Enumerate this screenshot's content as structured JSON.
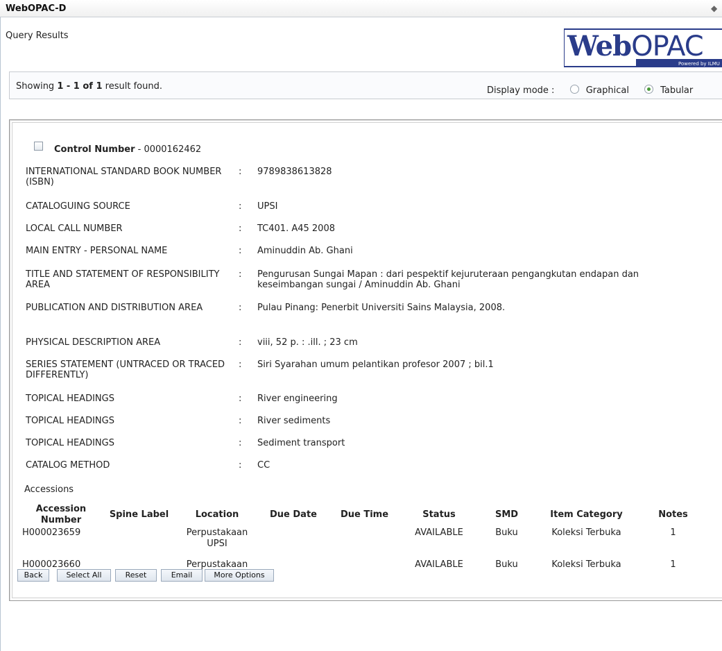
{
  "window": {
    "title": "WebOPAC-D"
  },
  "page": {
    "heading": "Query Results"
  },
  "logo": {
    "text": "WebOPAC",
    "tagline": "Powered by ILMU"
  },
  "results": {
    "prefix": "Showing ",
    "range": "1 - 1 of 1",
    "suffix": " result found."
  },
  "display_mode": {
    "label": "Display mode :",
    "options": [
      {
        "label": "Graphical",
        "selected": false
      },
      {
        "label": "Tabular",
        "selected": true
      }
    ]
  },
  "record": {
    "control_label": "Control Number",
    "control_value": " - 0000162462",
    "fields": [
      {
        "label": "INTERNATIONAL STANDARD BOOK NUMBER (ISBN)",
        "value": "9789838613828"
      },
      {
        "label": "CATALOGUING SOURCE",
        "value": "UPSI"
      },
      {
        "label": "LOCAL CALL NUMBER",
        "value": "TC401. A45 2008"
      },
      {
        "label": "MAIN ENTRY - PERSONAL NAME",
        "value": "Aminuddin Ab. Ghani"
      },
      {
        "label": "TITLE AND STATEMENT OF RESPONSIBILITY AREA",
        "value": "Pengurusan Sungai Mapan : dari pespektif kejuruteraan pengangkutan endapan dan keseimbangan sungai / Aminuddin Ab. Ghani"
      },
      {
        "label": "PUBLICATION AND DISTRIBUTION AREA",
        "value": "Pulau Pinang: Penerbit Universiti Sains Malaysia, 2008."
      },
      {
        "label": "PHYSICAL DESCRIPTION AREA",
        "value": "viii, 52 p. : .ill. ; 23 cm"
      },
      {
        "label": "SERIES STATEMENT (UNTRACED OR TRACED DIFFERENTLY)",
        "value": "Siri Syarahan umum pelantikan profesor 2007 ; bil.1"
      },
      {
        "label": "TOPICAL HEADINGS",
        "value": "River engineering"
      },
      {
        "label": "TOPICAL HEADINGS",
        "value": "River sediments"
      },
      {
        "label": "TOPICAL HEADINGS",
        "value": "Sediment transport"
      },
      {
        "label": "CATALOG METHOD",
        "value": "CC"
      }
    ],
    "separator": ":"
  },
  "accessions": {
    "title": "Accessions",
    "columns": [
      "Accession Number",
      "Spine Label",
      "Location",
      "Due Date",
      "Due Time",
      "Status",
      "SMD",
      "Item Category",
      "Notes"
    ],
    "rows": [
      [
        "H000023659",
        "",
        "Perpustakaan UPSI",
        "",
        "",
        "AVAILABLE",
        "Buku",
        "Koleksi Terbuka",
        "1"
      ],
      [
        "H000023660",
        "",
        "Perpustakaan UPSI",
        "",
        "",
        "AVAILABLE",
        "Buku",
        "Koleksi Terbuka",
        "1"
      ]
    ]
  },
  "buttons": [
    "Back",
    "Select All",
    "Reset",
    "Email",
    "More Options"
  ]
}
